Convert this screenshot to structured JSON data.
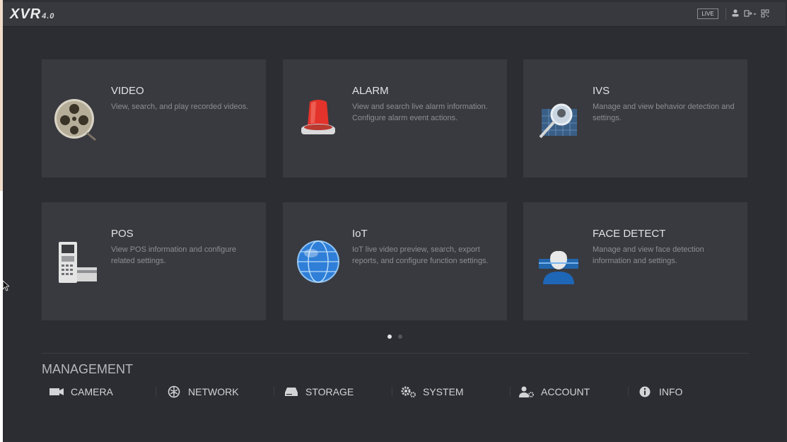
{
  "header": {
    "logo": "XVR",
    "logo_version": "4.0",
    "live_label": "LIVE",
    "icons": [
      "user-icon",
      "logout-icon",
      "qr-code-icon"
    ]
  },
  "tiles": [
    {
      "title": "VIDEO",
      "description": "View, search, and play recorded videos.",
      "icon": "film-reel-icon"
    },
    {
      "title": "ALARM",
      "description": "View and search live alarm information. Configure alarm event actions.",
      "icon": "alarm-light-icon"
    },
    {
      "title": "IVS",
      "description": "Manage and view behavior detection and settings.",
      "icon": "magnifier-icon"
    },
    {
      "title": "POS",
      "description": "View POS information and configure related settings.",
      "icon": "pos-terminal-icon"
    },
    {
      "title": "IoT",
      "description": "IoT live video preview, search, export reports, and configure function settings.",
      "icon": "globe-icon"
    },
    {
      "title": "FACE DETECT",
      "description": "Manage and view face detection information and settings.",
      "icon": "face-scan-icon"
    }
  ],
  "pager": {
    "pages": 2,
    "current": 1
  },
  "management": {
    "title": "MANAGEMENT",
    "items": [
      {
        "label": "CAMERA",
        "icon": "camera-icon"
      },
      {
        "label": "NETWORK",
        "icon": "network-icon"
      },
      {
        "label": "STORAGE",
        "icon": "storage-icon"
      },
      {
        "label": "SYSTEM",
        "icon": "gears-icon"
      },
      {
        "label": "ACCOUNT",
        "icon": "account-icon"
      },
      {
        "label": "INFO",
        "icon": "info-icon"
      }
    ]
  },
  "colors": {
    "background": "#2c2d32",
    "tile": "#393a3f",
    "topbar": "#38393e",
    "alarm_red": "#e3332a",
    "globe_blue": "#2f7fd8"
  }
}
